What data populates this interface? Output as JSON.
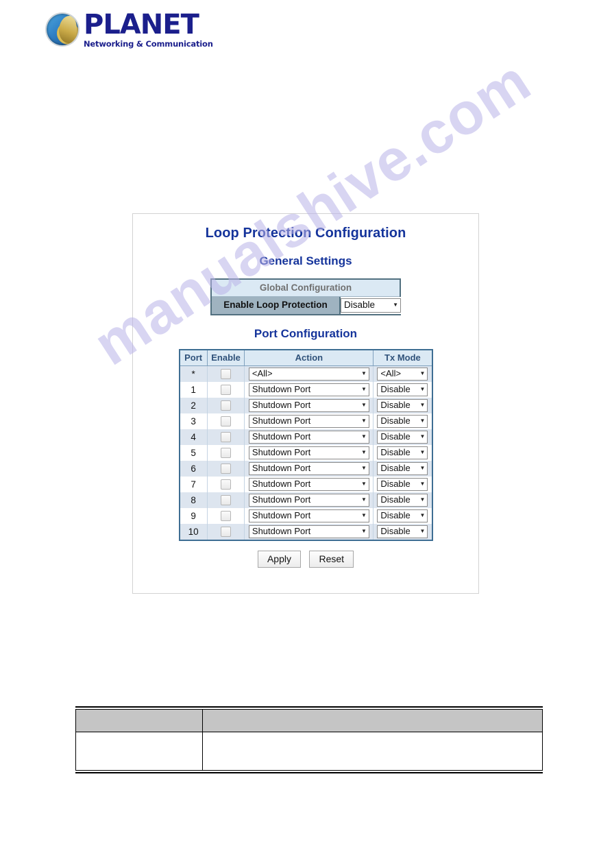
{
  "brand": {
    "logo_icon": "planet-globe-icon",
    "name": "PLANET",
    "tagline": "Networking & Communication"
  },
  "watermark": {
    "text": "manualshive.com"
  },
  "screenshot": {
    "title": "Loop Protection Configuration",
    "general_settings_heading": "General Settings",
    "global_configuration": {
      "header": "Global Configuration",
      "enable_label": "Enable Loop Protection",
      "enable_value": "Disable",
      "dropdown_icon": "chevron-down-icon"
    },
    "port_configuration_heading": "Port Configuration",
    "port_table": {
      "columns": [
        "Port",
        "Enable",
        "Action",
        "Tx Mode"
      ],
      "rows": [
        {
          "port": "*",
          "enable": false,
          "action": "<All>",
          "tx_mode": "<All>"
        },
        {
          "port": "1",
          "enable": false,
          "action": "Shutdown Port",
          "tx_mode": "Disable"
        },
        {
          "port": "2",
          "enable": false,
          "action": "Shutdown Port",
          "tx_mode": "Disable"
        },
        {
          "port": "3",
          "enable": false,
          "action": "Shutdown Port",
          "tx_mode": "Disable"
        },
        {
          "port": "4",
          "enable": false,
          "action": "Shutdown Port",
          "tx_mode": "Disable"
        },
        {
          "port": "5",
          "enable": false,
          "action": "Shutdown Port",
          "tx_mode": "Disable"
        },
        {
          "port": "6",
          "enable": false,
          "action": "Shutdown Port",
          "tx_mode": "Disable"
        },
        {
          "port": "7",
          "enable": false,
          "action": "Shutdown Port",
          "tx_mode": "Disable"
        },
        {
          "port": "8",
          "enable": false,
          "action": "Shutdown Port",
          "tx_mode": "Disable"
        },
        {
          "port": "9",
          "enable": false,
          "action": "Shutdown Port",
          "tx_mode": "Disable"
        },
        {
          "port": "10",
          "enable": false,
          "action": "Shutdown Port",
          "tx_mode": "Disable"
        }
      ]
    },
    "buttons": {
      "apply": "Apply",
      "reset": "Reset"
    }
  },
  "description_table": {
    "header_cells": [
      "",
      ""
    ],
    "body_cells": [
      "",
      ""
    ]
  },
  "colors": {
    "heading_blue": "#15349b",
    "brand_blue": "#1b1f8c",
    "table_border": "#3e6e93",
    "table_header_bg": "#dbe9f4",
    "row_alt_bg": "#dde5ef",
    "global_label_bg": "#9fb3c0",
    "watermark": "#b9b3e8",
    "desc_header_bg": "#c5c5c5"
  }
}
